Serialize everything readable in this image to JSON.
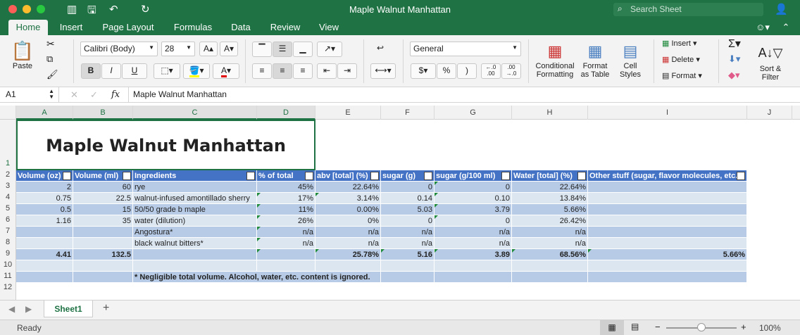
{
  "window": {
    "title": "Maple Walnut Manhattan",
    "search_placeholder": "Search Sheet"
  },
  "tabs": [
    "Home",
    "Insert",
    "Page Layout",
    "Formulas",
    "Data",
    "Review",
    "View"
  ],
  "ribbon": {
    "paste": "Paste",
    "font_name": "Calibri (Body)",
    "font_size": "28",
    "bold": "B",
    "italic": "I",
    "underline": "U",
    "number_format": "General",
    "currency": "$",
    "percent": "%",
    "comma": ")",
    "inc_dec": ".0\n.00",
    "dec_dec": ".00\n.0",
    "conditional_formatting": "Conditional Formatting",
    "format_as_table": "Format as Table",
    "cell_styles": "Cell Styles",
    "insert": "Insert",
    "delete": "Delete",
    "format": "Format",
    "sort_filter": "Sort & Filter"
  },
  "formula_bar": {
    "cell_ref": "A1",
    "fx": "fx",
    "content": "Maple Walnut Manhattan"
  },
  "columns": [
    "A",
    "B",
    "C",
    "D",
    "E",
    "F",
    "G",
    "H",
    "I",
    "J"
  ],
  "rows": [
    "1",
    "2",
    "3",
    "4",
    "5",
    "6",
    "7",
    "8",
    "9",
    "10",
    "11",
    "12"
  ],
  "sheet": {
    "title": "Maple Walnut Manhattan",
    "headers": [
      "Volume (oz)",
      "Volume (ml)",
      "Ingredients",
      "% of total",
      "abv [total] (%)",
      "sugar (g)",
      "sugar (g/100 ml)",
      "Water [total] (%)",
      "Other stuff (sugar, flavor molecules, etc.)"
    ],
    "data": [
      [
        "2",
        "60",
        "rye",
        "45%",
        "22.64%",
        "0",
        "0",
        "22.64%",
        ""
      ],
      [
        "0.75",
        "22.5",
        "walnut-infused amontillado sherry",
        "17%",
        "3.14%",
        "0.14",
        "0.10",
        "13.84%",
        ""
      ],
      [
        "0.5",
        "15",
        "50/50 grade b maple",
        "11%",
        "0.00%",
        "5.03",
        "3.79",
        "5.66%",
        ""
      ],
      [
        "1.16",
        "35",
        "water (dilution)",
        "26%",
        "0%",
        "0",
        "0",
        "26.42%",
        ""
      ],
      [
        "",
        "",
        "Angostura*",
        "n/a",
        "n/a",
        "n/a",
        "n/a",
        "n/a",
        ""
      ],
      [
        "",
        "",
        "black walnut bitters*",
        "n/a",
        "n/a",
        "n/a",
        "n/a",
        "n/a",
        ""
      ],
      [
        "4.41",
        "132.5",
        "",
        "",
        "25.78%",
        "5.16",
        "3.89",
        "68.56%",
        "5.66%"
      ]
    ],
    "note": "* Negligible total volume. Alcohol, water, etc. content is ignored."
  },
  "bottom": {
    "sheet_tab": "Sheet1",
    "add": "+"
  },
  "status": {
    "ready": "Ready",
    "zoom": "100%"
  },
  "colors": {
    "accent": "#1f7244",
    "table_dark": "#b7cbe6",
    "table_light": "#dce6f1",
    "header": "#4472c4"
  }
}
